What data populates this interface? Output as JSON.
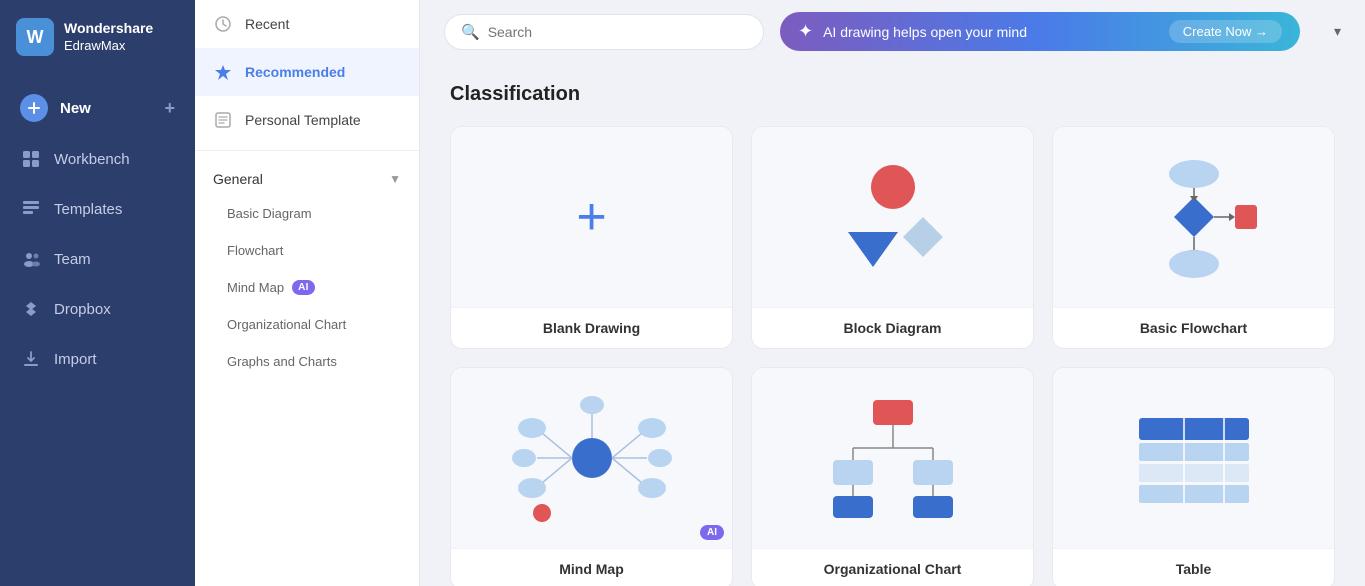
{
  "app": {
    "brand_line1": "Wondershare",
    "brand_line2": "EdrawMax",
    "logo_letter": "W"
  },
  "sidebar": {
    "items": [
      {
        "id": "new",
        "label": "New",
        "icon": "new-icon"
      },
      {
        "id": "workbench",
        "label": "Workbench",
        "icon": "workbench-icon"
      },
      {
        "id": "templates",
        "label": "Templates",
        "icon": "templates-icon"
      },
      {
        "id": "team",
        "label": "Team",
        "icon": "team-icon"
      },
      {
        "id": "dropbox",
        "label": "Dropbox",
        "icon": "dropbox-icon"
      },
      {
        "id": "import",
        "label": "Import",
        "icon": "import-icon"
      }
    ]
  },
  "middle_panel": {
    "items": [
      {
        "id": "recent",
        "label": "Recent",
        "active": false
      },
      {
        "id": "recommended",
        "label": "Recommended",
        "active": true
      },
      {
        "id": "personal_template",
        "label": "Personal Template",
        "active": false
      }
    ],
    "general_section": {
      "label": "General",
      "sub_items": [
        {
          "id": "basic_diagram",
          "label": "Basic Diagram",
          "has_ai": false
        },
        {
          "id": "flowchart",
          "label": "Flowchart",
          "has_ai": false
        },
        {
          "id": "mind_map",
          "label": "Mind Map",
          "has_ai": true
        },
        {
          "id": "org_chart",
          "label": "Organizational Chart",
          "has_ai": false
        },
        {
          "id": "graphs_charts",
          "label": "Graphs and Charts",
          "has_ai": false
        }
      ]
    }
  },
  "topbar": {
    "search_placeholder": "Search",
    "ai_banner_text": "AI drawing helps open your mind",
    "ai_banner_btn": "Create Now →"
  },
  "main": {
    "section_title": "Classification",
    "cards": [
      {
        "id": "blank_drawing",
        "label": "Blank Drawing",
        "type": "blank",
        "has_ai": false
      },
      {
        "id": "block_diagram",
        "label": "Block Diagram",
        "type": "block",
        "has_ai": false
      },
      {
        "id": "basic_flowchart",
        "label": "Basic Flowchart",
        "type": "flowchart",
        "has_ai": false
      },
      {
        "id": "mind_map_card",
        "label": "Mind Map",
        "type": "mindmap",
        "has_ai": true
      },
      {
        "id": "org_chart_card",
        "label": "Organizational Chart",
        "type": "orgchart",
        "has_ai": false
      },
      {
        "id": "table_card",
        "label": "Table",
        "type": "table",
        "has_ai": false
      }
    ]
  }
}
